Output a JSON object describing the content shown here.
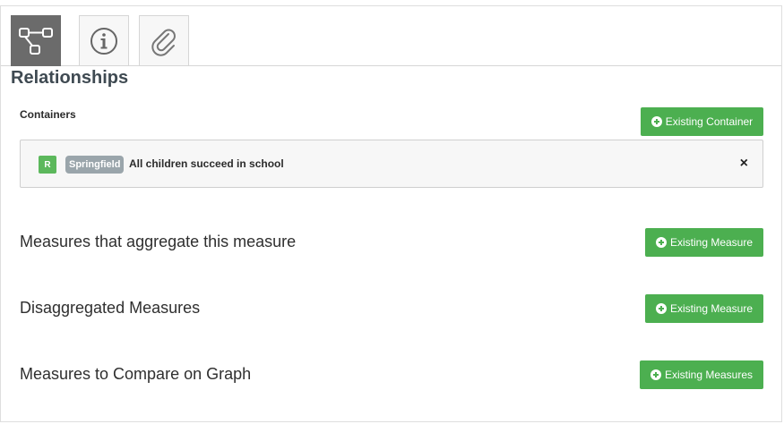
{
  "tabs": [
    {
      "icon": "relationships-icon",
      "active": true
    },
    {
      "icon": "info-icon",
      "active": false
    },
    {
      "icon": "paperclip-icon",
      "active": false
    }
  ],
  "title": "Relationships",
  "containers": {
    "label": "Containers",
    "button_label": "Existing Container",
    "items": [
      {
        "badge": "R",
        "org": "Springfield",
        "name": "All children succeed in school",
        "remove": "×"
      }
    ]
  },
  "sections": [
    {
      "label": "Measures that aggregate this measure",
      "button_label": "Existing Measure"
    },
    {
      "label": "Disaggregated Measures",
      "button_label": "Existing Measure"
    },
    {
      "label": "Measures to Compare on Graph",
      "button_label": "Existing Measures"
    }
  ],
  "colors": {
    "accent_green": "#4caf50",
    "active_tab": "#6b6b6b",
    "org_pill": "#9aa5ab"
  }
}
